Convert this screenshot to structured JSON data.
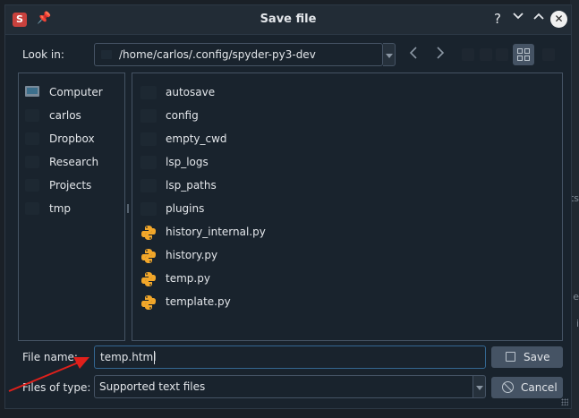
{
  "window": {
    "title": "Save file",
    "app_icon": "spyder-logo-icon",
    "buttons": {
      "help": "?",
      "minimize": "⌄",
      "maximize": "⌃",
      "close": "✕"
    }
  },
  "lookin": {
    "label": "Look in:",
    "path": "/home/carlos/.config/spyder-py3-dev"
  },
  "sidebar": {
    "items": [
      {
        "label": "Computer",
        "icon": "computer-icon"
      },
      {
        "label": "carlos",
        "icon": "folder-icon"
      },
      {
        "label": "Dropbox",
        "icon": "folder-icon"
      },
      {
        "label": "Research",
        "icon": "folder-icon"
      },
      {
        "label": "Projects",
        "icon": "folder-icon"
      },
      {
        "label": "tmp",
        "icon": "folder-icon"
      }
    ]
  },
  "files": {
    "items": [
      {
        "name": "autosave",
        "icon": "folder-icon"
      },
      {
        "name": "config",
        "icon": "folder-icon"
      },
      {
        "name": "empty_cwd",
        "icon": "folder-icon"
      },
      {
        "name": "lsp_logs",
        "icon": "folder-icon"
      },
      {
        "name": "lsp_paths",
        "icon": "folder-icon"
      },
      {
        "name": "plugins",
        "icon": "folder-icon"
      },
      {
        "name": "history_internal.py",
        "icon": "python-file-icon"
      },
      {
        "name": "history.py",
        "icon": "python-file-icon"
      },
      {
        "name": "temp.py",
        "icon": "python-file-icon"
      },
      {
        "name": "template.py",
        "icon": "python-file-icon"
      }
    ]
  },
  "filename": {
    "label": "File name:",
    "value": "temp.html"
  },
  "filetype": {
    "label": "Files of type:",
    "value": "Supported text files"
  },
  "actions": {
    "save_label": "Save",
    "cancel_label": "Cancel"
  },
  "colors": {
    "background": "#19232d",
    "border": "#455364",
    "focus": "#346792",
    "annotation_arrow": "#e0201b"
  }
}
